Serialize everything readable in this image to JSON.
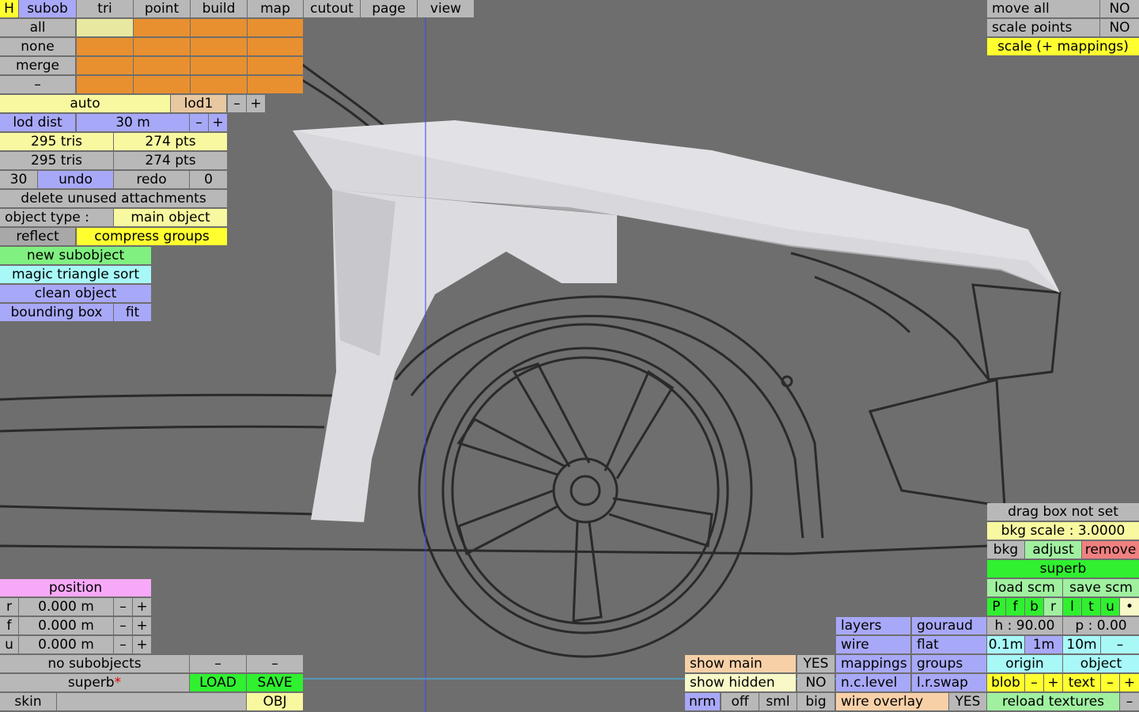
{
  "top_tabs": [
    "H",
    "subob",
    "tri",
    "point",
    "build",
    "map",
    "cutout",
    "page",
    "view"
  ],
  "select": {
    "all": "all",
    "none": "none",
    "merge": "merge",
    "minus": "–"
  },
  "lod": {
    "auto": "auto",
    "name": "lod1",
    "minus": "–",
    "plus": "+",
    "dist_label": "lod dist",
    "dist_value": "30 m"
  },
  "counts": {
    "tris1": "295 tris",
    "pts1": "274 pts",
    "tris2": "295 tris",
    "pts2": "274 pts"
  },
  "undo": {
    "left": "30",
    "undo": "undo",
    "redo": "redo",
    "right": "0"
  },
  "delete_unused": "delete unused attachments",
  "object_type": {
    "label": "object type :",
    "value": "main object"
  },
  "reflect": "reflect",
  "compress": "compress groups",
  "new_subobject": "new subobject",
  "magic_sort": "magic triangle sort",
  "clean_object": "clean object",
  "bounding_box": "bounding box",
  "fit": "fit",
  "position": {
    "title": "position",
    "rows": [
      {
        "axis": "r",
        "value": "0.000 m"
      },
      {
        "axis": "f",
        "value": "0.000 m"
      },
      {
        "axis": "u",
        "value": "0.000 m"
      }
    ],
    "minus": "–",
    "plus": "+"
  },
  "bottom_left": {
    "no_subobjects": "no subobjects",
    "dash": "–",
    "superb": "superb",
    "star": "*",
    "load": "LOAD",
    "save": "SAVE",
    "skin": "skin",
    "obj": "OBJ"
  },
  "top_right": {
    "move_all": "move all",
    "move_all_val": "NO",
    "scale_points": "scale points",
    "scale_points_val": "NO",
    "scale_mappings": "scale (+ mappings)"
  },
  "right_panel": {
    "drag_box": "drag box not set",
    "bkg_scale": "bkg scale : 3.0000",
    "bkg": "bkg",
    "adjust": "adjust",
    "remove": "remove",
    "superb": "superb",
    "load_scm": "load scm",
    "save_scm": "save scm",
    "toggles": [
      "P",
      "f",
      "b",
      "r",
      "l",
      "t",
      "u"
    ],
    "dot": "•",
    "h": "h : 90.00",
    "p": "p : 0.00",
    "steps": [
      "0.1m",
      "1m",
      "10m",
      "–"
    ],
    "origin": "origin",
    "object": "object",
    "blob": "blob",
    "minus": "–",
    "plus": "+",
    "text": "text",
    "reload": "reload textures"
  },
  "bottom_mid": {
    "show_main": "show main",
    "show_main_val": "YES",
    "show_hidden": "show hidden",
    "show_hidden_val": "NO",
    "nrm": "nrm",
    "off": "off",
    "sml": "sml",
    "big": "big",
    "layers": "layers",
    "gouraud": "gouraud",
    "wire": "wire",
    "flat": "flat",
    "mappings": "mappings",
    "groups": "groups",
    "nclevel": "n.c.level",
    "lrswap": "l.r.swap",
    "wire_overlay": "wire overlay",
    "wire_overlay_val": "YES"
  },
  "colors": {
    "background": "#6e6e6e",
    "fender": "#e8e8ec",
    "lines": "#2a2a2a"
  }
}
